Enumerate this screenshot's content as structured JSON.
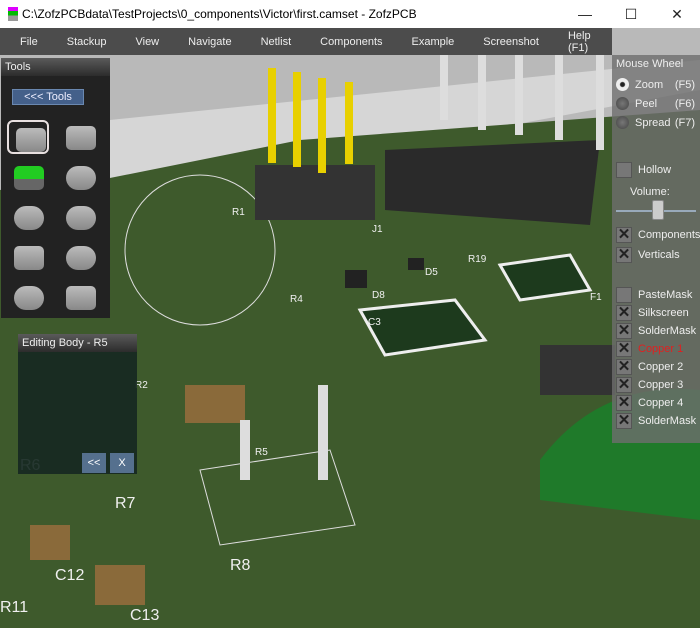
{
  "window": {
    "title": "C:\\ZofzPCBdata\\TestProjects\\0_components\\Victor\\first.camset - ZofzPCB",
    "minimize": "—",
    "maximize": "☐",
    "close": "✕"
  },
  "menu": [
    "File",
    "Stackup",
    "View",
    "Navigate",
    "Netlist",
    "Components",
    "Example",
    "Screenshot",
    "Help (F1)"
  ],
  "tools": {
    "title": "Tools",
    "collapse_label": "<<< Tools",
    "items": [
      "box",
      "chamfered-box",
      "bent-sheet",
      "cylinder-flange",
      "cylinder-horizontal",
      "dome",
      "box-rounded",
      "half-cylinder",
      "pill-flange",
      "hex-nut"
    ],
    "selected": 0
  },
  "edit_body": {
    "title": "Editing Body - R5",
    "back_label": "<<",
    "close_label": "X"
  },
  "mouse_wheel": {
    "title": "Mouse Wheel",
    "options": [
      {
        "label": "Zoom",
        "key": "(F5)",
        "selected": true
      },
      {
        "label": "Peel",
        "key": "(F6)",
        "selected": false
      },
      {
        "label": "Spread",
        "key": "(F7)",
        "selected": false
      }
    ]
  },
  "hollow": {
    "label": "Hollow",
    "checked": false
  },
  "volume": {
    "label": "Volume:",
    "value": 0.55
  },
  "view_toggles": [
    {
      "label": "Components",
      "checked": true
    },
    {
      "label": "Verticals",
      "checked": true
    }
  ],
  "layers": [
    {
      "label": "PasteMask",
      "checked": false,
      "active": false
    },
    {
      "label": "Silkscreen",
      "checked": true,
      "active": false
    },
    {
      "label": "SolderMask",
      "checked": true,
      "active": false
    },
    {
      "label": "Copper  1",
      "checked": true,
      "active": true
    },
    {
      "label": "Copper  2",
      "checked": true,
      "active": false
    },
    {
      "label": "Copper  3",
      "checked": true,
      "active": false
    },
    {
      "label": "Copper  4",
      "checked": true,
      "active": false
    },
    {
      "label": "SolderMask",
      "checked": true,
      "active": false
    }
  ],
  "colors": {
    "active_layer": "#e02020",
    "pcb": "#3e5a2c"
  },
  "silkscreen_labels": [
    "R1",
    "J1",
    "R19",
    "D5",
    "D8",
    "R4",
    "F1",
    "C3",
    "R2",
    "R5",
    "R6",
    "R7",
    "C12",
    "C13",
    "R8",
    "R11"
  ]
}
